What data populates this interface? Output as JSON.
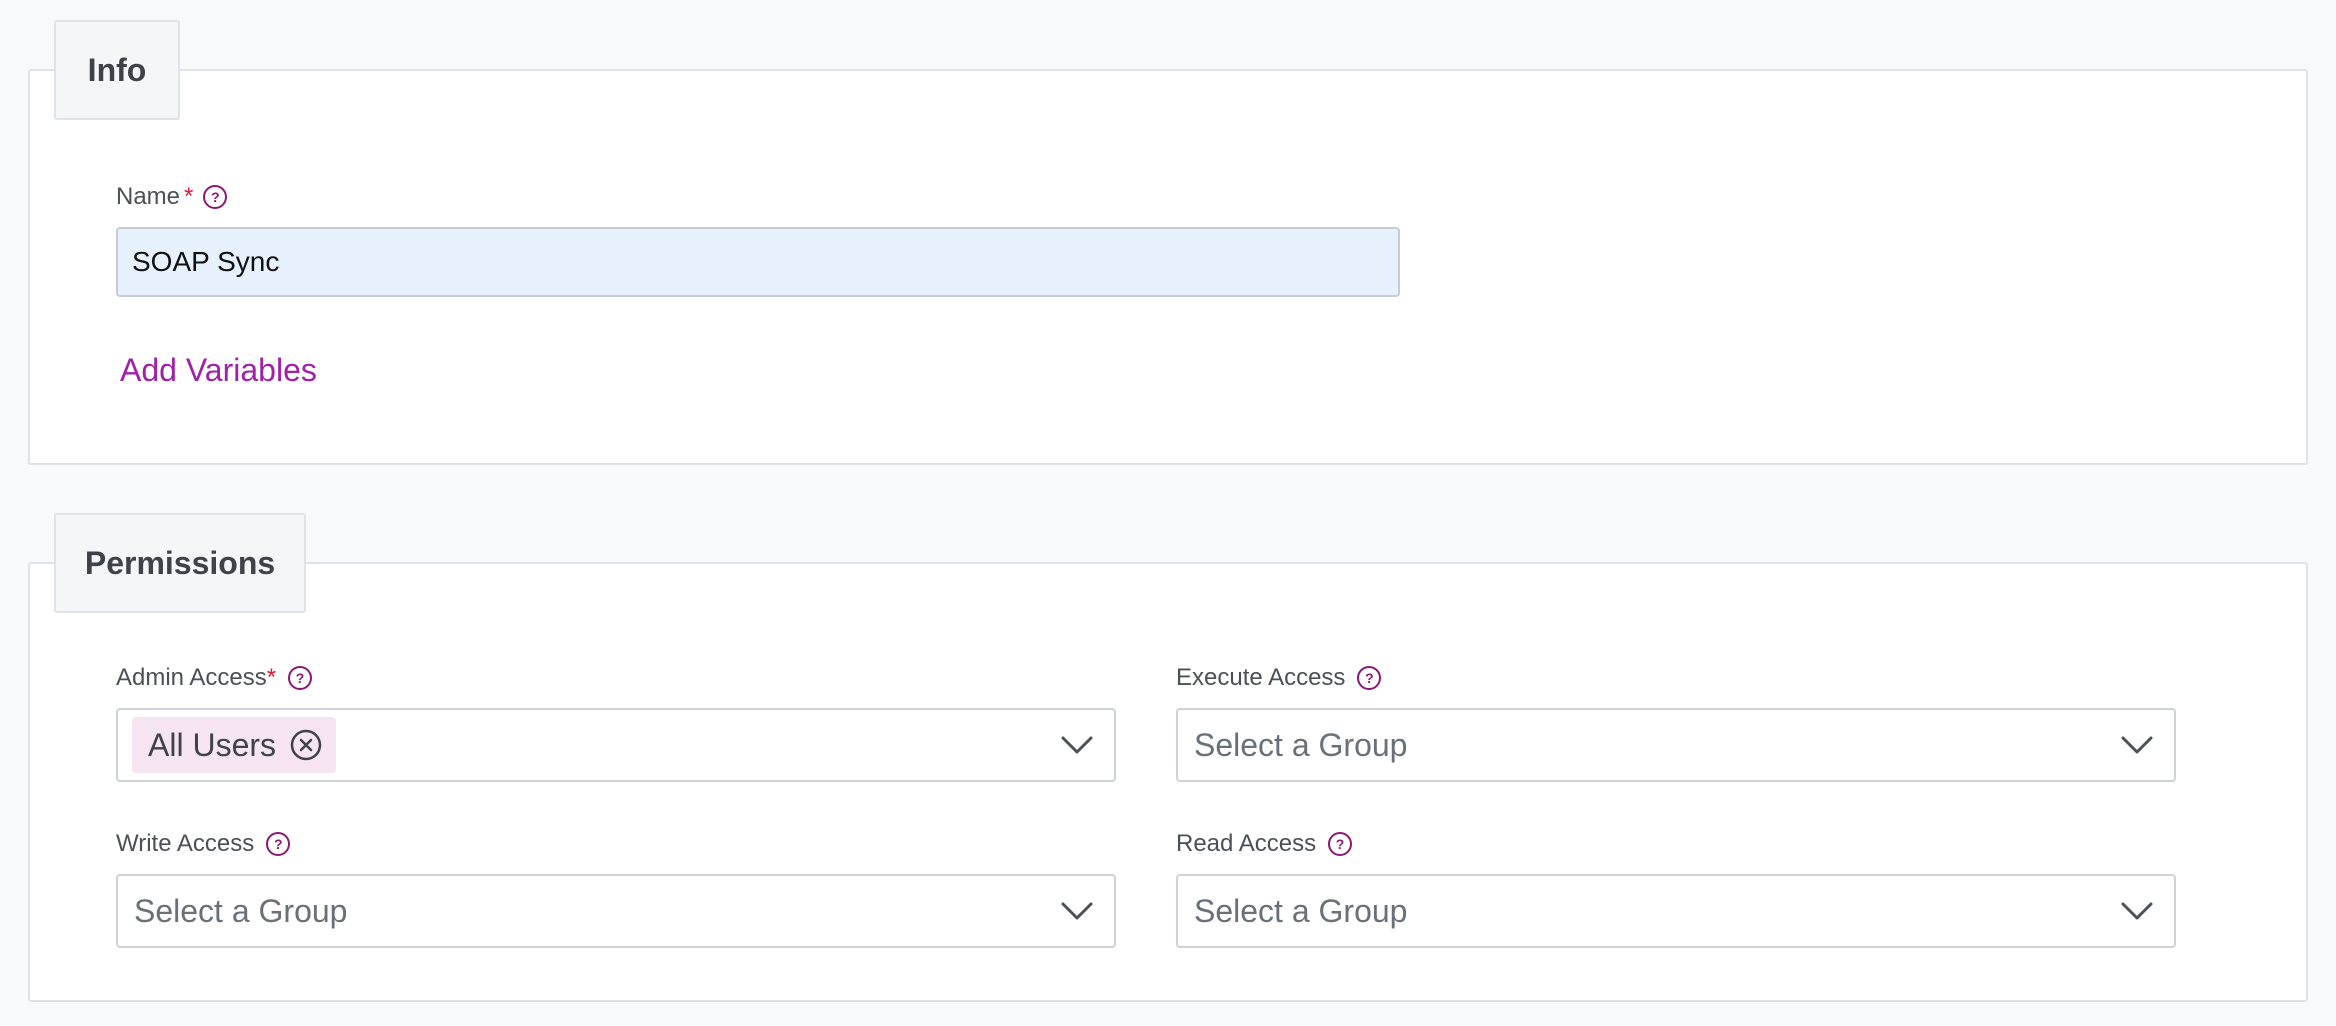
{
  "info": {
    "legend": "Info",
    "name_label": "Name",
    "name_required": "*",
    "name_value": "SOAP Sync",
    "add_variables": "Add Variables"
  },
  "permissions": {
    "legend": "Permissions",
    "admin": {
      "label": "Admin Access",
      "required": "*",
      "chip": "All Users"
    },
    "execute": {
      "label": "Execute Access",
      "placeholder": "Select a Group"
    },
    "write": {
      "label": "Write Access",
      "placeholder": "Select a Group"
    },
    "read": {
      "label": "Read Access",
      "placeholder": "Select a Group"
    }
  },
  "icons": {
    "help": "question-circle-icon",
    "chevron": "chevron-down-icon",
    "chip_remove": "x-circle-icon"
  },
  "colors": {
    "accent": "#a020a8",
    "help_icon": "#8a1872",
    "required": "#d9183b",
    "chip_bg": "#f6e4f2",
    "input_bg": "#e7f0fd"
  }
}
